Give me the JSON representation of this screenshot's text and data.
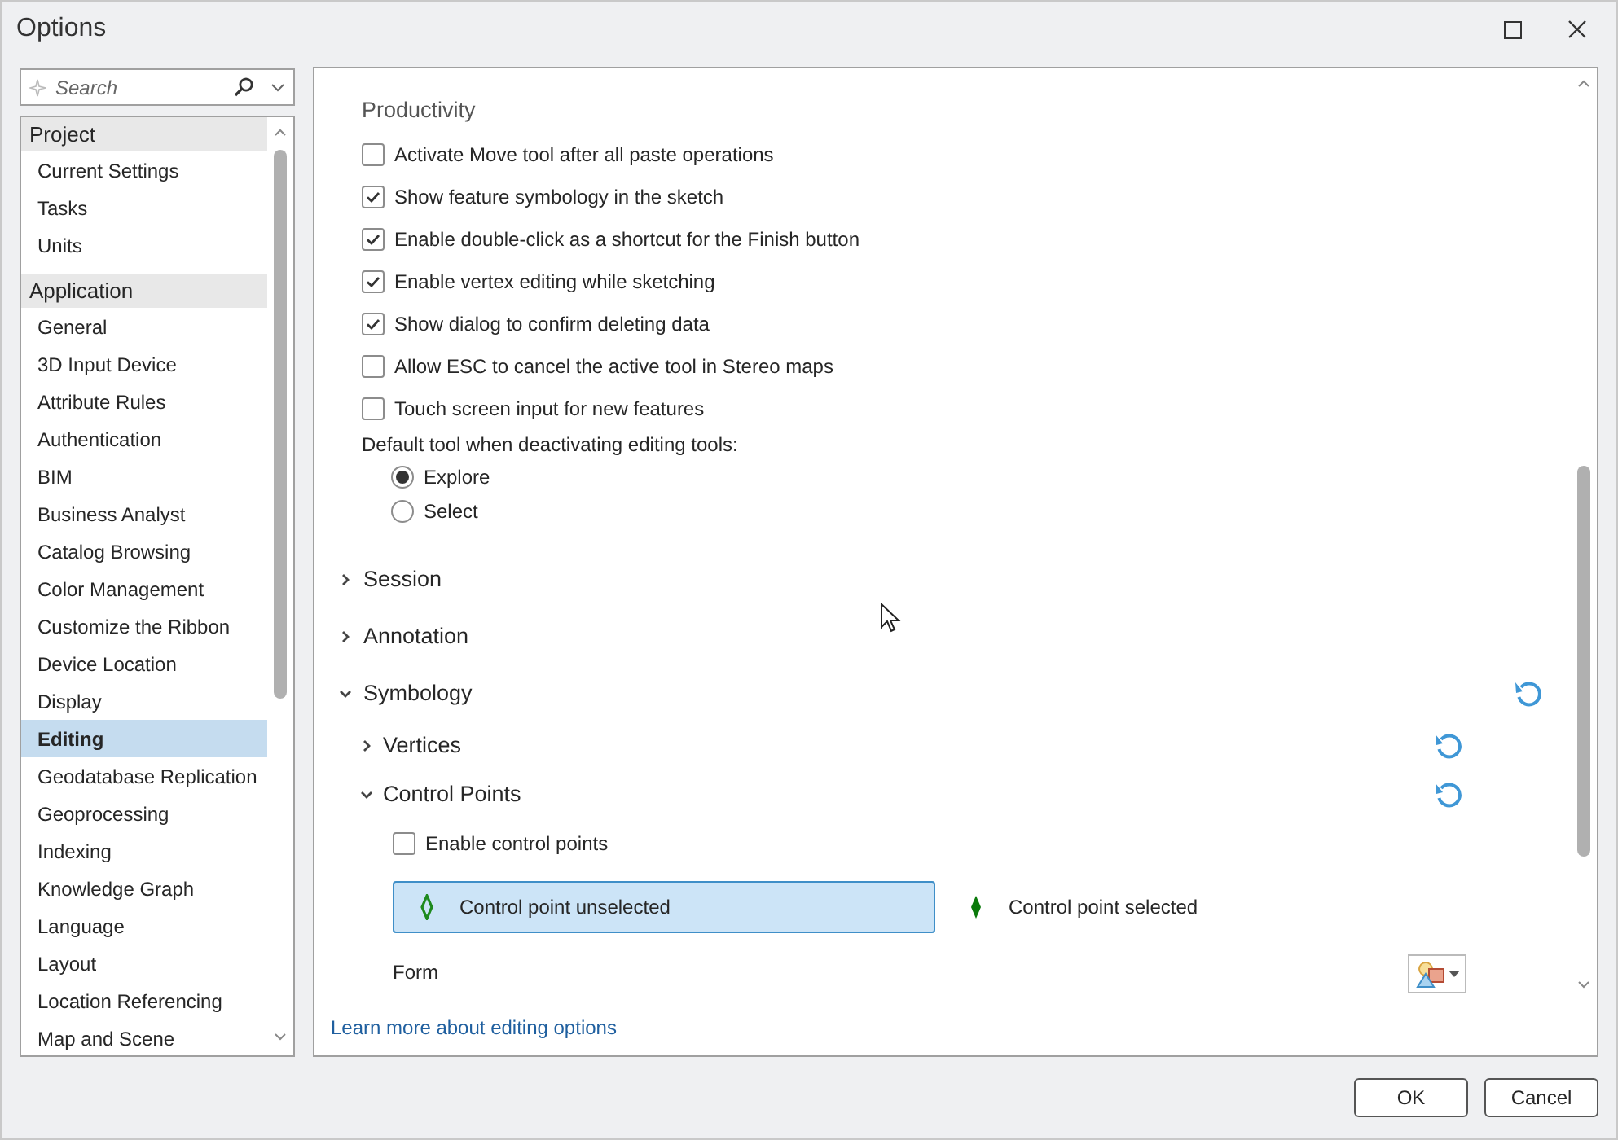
{
  "window": {
    "title": "Options"
  },
  "search": {
    "placeholder": "Search"
  },
  "nav": [
    {
      "label": "Project",
      "items": [
        {
          "label": "Current Settings",
          "selected": false
        },
        {
          "label": "Tasks",
          "selected": false
        },
        {
          "label": "Units",
          "selected": false
        }
      ]
    },
    {
      "label": "Application",
      "items": [
        {
          "label": "General",
          "selected": false
        },
        {
          "label": "3D Input Device",
          "selected": false
        },
        {
          "label": "Attribute Rules",
          "selected": false
        },
        {
          "label": "Authentication",
          "selected": false
        },
        {
          "label": "BIM",
          "selected": false
        },
        {
          "label": "Business Analyst",
          "selected": false
        },
        {
          "label": "Catalog Browsing",
          "selected": false
        },
        {
          "label": "Color Management",
          "selected": false
        },
        {
          "label": "Customize the Ribbon",
          "selected": false
        },
        {
          "label": "Device Location",
          "selected": false
        },
        {
          "label": "Display",
          "selected": false
        },
        {
          "label": "Editing",
          "selected": true
        },
        {
          "label": "Geodatabase Replication",
          "selected": false
        },
        {
          "label": "Geoprocessing",
          "selected": false
        },
        {
          "label": "Indexing",
          "selected": false
        },
        {
          "label": "Knowledge Graph",
          "selected": false
        },
        {
          "label": "Language",
          "selected": false
        },
        {
          "label": "Layout",
          "selected": false
        },
        {
          "label": "Location Referencing",
          "selected": false
        },
        {
          "label": "Map and Scene",
          "selected": false
        }
      ]
    }
  ],
  "content": {
    "heading": "Productivity",
    "options": [
      {
        "label": "Activate Move tool after all paste operations",
        "checked": false
      },
      {
        "label": "Show feature symbology in the sketch",
        "checked": true
      },
      {
        "label": "Enable double-click as a shortcut for the Finish button",
        "checked": true
      },
      {
        "label": "Enable vertex editing while sketching",
        "checked": true
      },
      {
        "label": "Show dialog to confirm deleting data",
        "checked": true
      },
      {
        "label": "Allow ESC to cancel the active tool in Stereo maps",
        "checked": false
      },
      {
        "label": "Touch screen input for new features",
        "checked": false
      }
    ],
    "default_tool": {
      "label": "Default tool when deactivating editing tools:",
      "choices": [
        {
          "label": "Explore",
          "selected": true
        },
        {
          "label": "Select",
          "selected": false
        }
      ]
    },
    "sections": [
      {
        "label": "Session",
        "expanded": false,
        "reset": false
      },
      {
        "label": "Annotation",
        "expanded": false,
        "reset": false
      },
      {
        "label": "Symbology",
        "expanded": true,
        "reset": true,
        "children": [
          {
            "label": "Vertices",
            "expanded": false,
            "reset": true
          },
          {
            "label": "Control Points",
            "expanded": true,
            "reset": true,
            "enable": {
              "label": "Enable control points",
              "checked": false
            },
            "symbols": [
              {
                "label": "Control point unselected",
                "kind": "hollow",
                "selected": true
              },
              {
                "label": "Control point selected",
                "kind": "solid",
                "selected": false
              }
            ],
            "form_label": "Form"
          }
        ]
      }
    ]
  },
  "link": "Learn more about editing options",
  "buttons": [
    "OK",
    "Cancel"
  ]
}
